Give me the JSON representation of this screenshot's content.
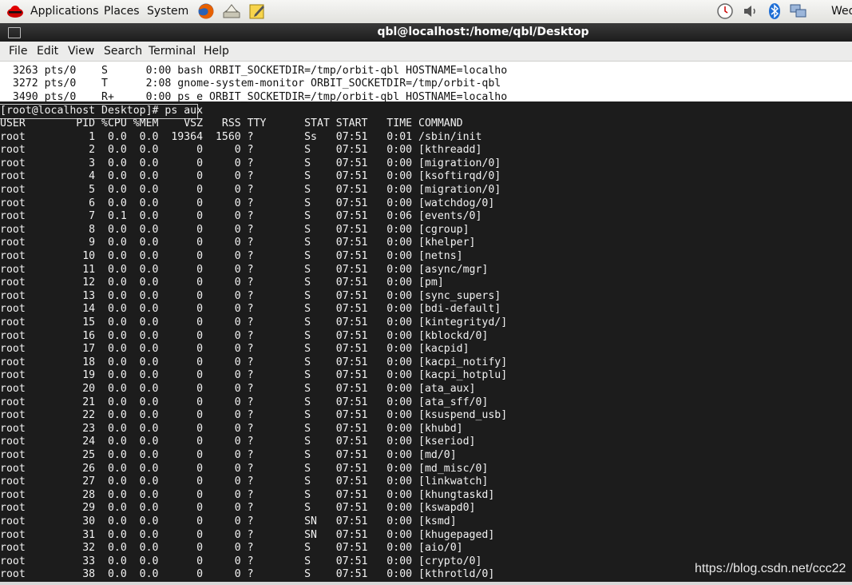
{
  "panel": {
    "menus": [
      {
        "label": "Applications",
        "name": "menu-applications"
      },
      {
        "label": "Places",
        "name": "menu-places"
      },
      {
        "label": "System",
        "name": "menu-system"
      }
    ],
    "launchers": [
      {
        "name": "firefox-icon",
        "color": "#e66000"
      },
      {
        "name": "mail-client-icon",
        "color": "#8a8a7a"
      },
      {
        "name": "notes-icon",
        "color": "#f0c419"
      }
    ],
    "tray": [
      {
        "name": "clock-icon"
      },
      {
        "name": "volume-icon"
      },
      {
        "name": "bluetooth-icon",
        "color": "#1f6fd6"
      },
      {
        "name": "network-icon",
        "color": "#4a6fa5"
      }
    ],
    "clock_text": "Wed"
  },
  "window": {
    "title": "qbl@localhost:/home/qbl/Desktop",
    "menu": [
      "File",
      "Edit",
      "View",
      "Search",
      "Terminal",
      "Help"
    ]
  },
  "terminal": {
    "history": [
      "  3263 pts/0    S      0:00 bash ORBIT_SOCKETDIR=/tmp/orbit-qbl HOSTNAME=localho",
      "  3272 pts/0    T      2:08 gnome-system-monitor ORBIT_SOCKETDIR=/tmp/orbit-qbl",
      "  3490 pts/0    R+     0:00 ps e ORBIT_SOCKETDIR=/tmp/orbit-qbl HOSTNAME=localho"
    ],
    "prompt": "[root@localhost Desktop]# ps aux",
    "header": "USER        PID %CPU %MEM    VSZ   RSS TTY      STAT START   TIME COMMAND",
    "rows": [
      "root          1  0.0  0.0  19364  1560 ?        Ss   07:51   0:01 /sbin/init",
      "root          2  0.0  0.0      0     0 ?        S    07:51   0:00 [kthreadd]",
      "root          3  0.0  0.0      0     0 ?        S    07:51   0:00 [migration/0]",
      "root          4  0.0  0.0      0     0 ?        S    07:51   0:00 [ksoftirqd/0]",
      "root          5  0.0  0.0      0     0 ?        S    07:51   0:00 [migration/0]",
      "root          6  0.0  0.0      0     0 ?        S    07:51   0:00 [watchdog/0]",
      "root          7  0.1  0.0      0     0 ?        S    07:51   0:06 [events/0]",
      "root          8  0.0  0.0      0     0 ?        S    07:51   0:00 [cgroup]",
      "root          9  0.0  0.0      0     0 ?        S    07:51   0:00 [khelper]",
      "root         10  0.0  0.0      0     0 ?        S    07:51   0:00 [netns]",
      "root         11  0.0  0.0      0     0 ?        S    07:51   0:00 [async/mgr]",
      "root         12  0.0  0.0      0     0 ?        S    07:51   0:00 [pm]",
      "root         13  0.0  0.0      0     0 ?        S    07:51   0:00 [sync_supers]",
      "root         14  0.0  0.0      0     0 ?        S    07:51   0:00 [bdi-default]",
      "root         15  0.0  0.0      0     0 ?        S    07:51   0:00 [kintegrityd/]",
      "root         16  0.0  0.0      0     0 ?        S    07:51   0:00 [kblockd/0]",
      "root         17  0.0  0.0      0     0 ?        S    07:51   0:00 [kacpid]",
      "root         18  0.0  0.0      0     0 ?        S    07:51   0:00 [kacpi_notify]",
      "root         19  0.0  0.0      0     0 ?        S    07:51   0:00 [kacpi_hotplu]",
      "root         20  0.0  0.0      0     0 ?        S    07:51   0:00 [ata_aux]",
      "root         21  0.0  0.0      0     0 ?        S    07:51   0:00 [ata_sff/0]",
      "root         22  0.0  0.0      0     0 ?        S    07:51   0:00 [ksuspend_usb]",
      "root         23  0.0  0.0      0     0 ?        S    07:51   0:00 [khubd]",
      "root         24  0.0  0.0      0     0 ?        S    07:51   0:00 [kseriod]",
      "root         25  0.0  0.0      0     0 ?        S    07:51   0:00 [md/0]",
      "root         26  0.0  0.0      0     0 ?        S    07:51   0:00 [md_misc/0]",
      "root         27  0.0  0.0      0     0 ?        S    07:51   0:00 [linkwatch]",
      "root         28  0.0  0.0      0     0 ?        S    07:51   0:00 [khungtaskd]",
      "root         29  0.0  0.0      0     0 ?        S    07:51   0:00 [kswapd0]",
      "root         30  0.0  0.0      0     0 ?        SN   07:51   0:00 [ksmd]",
      "root         31  0.0  0.0      0     0 ?        SN   07:51   0:00 [khugepaged]",
      "root         32  0.0  0.0      0     0 ?        S    07:51   0:00 [aio/0]",
      "root         33  0.0  0.0      0     0 ?        S    07:51   0:00 [crypto/0]",
      "root         38  0.0  0.0      0     0 ?        S    07:51   0:00 [kthrotld/0]"
    ]
  },
  "watermark": "https://blog.csdn.net/ccc22"
}
